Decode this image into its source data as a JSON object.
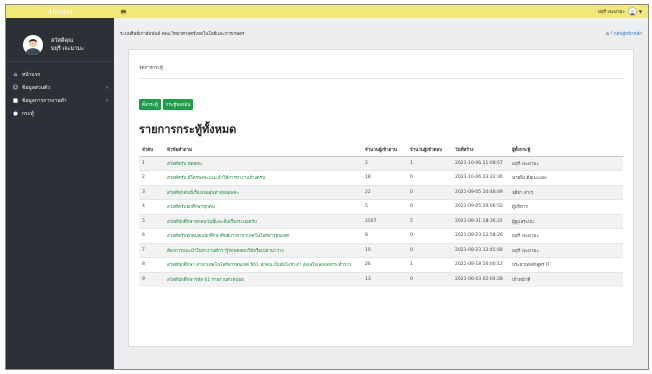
{
  "brand": {
    "logo_text": "Alumni"
  },
  "user": {
    "greeting": "สวัสดีคุณ",
    "name": "มยุรี เจะมามะ"
  },
  "sidebar": {
    "items": [
      {
        "label": "หน้าแรก",
        "icon": "home-icon",
        "has_arrow": false
      },
      {
        "label": "ข้อมูลส่วนตัว",
        "icon": "user-icon",
        "has_arrow": true
      },
      {
        "label": "ข้อมูลการการงานทำ",
        "icon": "briefcase-icon",
        "has_arrow": true
      },
      {
        "label": "กระทู้",
        "icon": "chat-icon",
        "has_arrow": false
      }
    ]
  },
  "topbar": {
    "user_name": "มยุรี เจะมามะ"
  },
  "header": {
    "page_heading": "ระบบศิษย์เก่าสัมพันธ์ คณะวิทยาศาสตร์เทคโนโลยีและการเกษตร",
    "breadcrumb": "กลับสู่หน้าหลัก"
  },
  "card": {
    "title": "จัดการกระทู้",
    "new_topic_button": "ตั้งกระทู้",
    "my_topics_button": "กระทู้ของฉัน",
    "list_title": "รายการกระทู้ทั้งหมด"
  },
  "table": {
    "columns": [
      "ลำดับ",
      "หัวข้อคำถาม",
      "จำนวนผู้เข้าอ่าน",
      "จำนวนผู้เข้าตอบ",
      "วันที่สร้าง",
      "ผู้ตั้งกระทู้"
    ],
    "rows": [
      [
        "1",
        "สวัสดีครับ ทดสอบ",
        "2",
        "1",
        "2021-10-06 11:08:57",
        "มยุรี เจะมามะ"
      ],
      [
        "2",
        "สวัสดีครับ มีใครพอจะแนะนำวิธีการหางานบ้างครับ",
        "18",
        "0",
        "2021-10-06 23:32:30",
        "นายยิง ดีสุเมะแยะ"
      ],
      [
        "3",
        "สวัสดีทุกคนนี่เรื่องเจอสุนทางหลอมคะ",
        "22",
        "0",
        "2021-09-05 10:48:49",
        "จุลียา สาเร"
      ],
      [
        "4",
        "สวัสดีครับนักศึกษาทุกคน",
        "5",
        "0",
        "2021-09-05 10:06:50",
        "ผู้บริหาร"
      ],
      [
        "5",
        "สวัสดีนักศึกษาทุกคนวันนี้และอินเรื่องระบบครับ",
        "2507",
        "5",
        "2021-08-31 18:36:22",
        "ผู้ดูแลระบบ"
      ],
      [
        "6",
        "สวัสดีครับทุกคนคนนักศึกษาศิษย์เก่าสาขาเทคโนโลยีสารสนเทศ",
        "8",
        "0",
        "2021-08-23 12:58:26",
        "มยุรี เจะมามะ"
      ],
      [
        "7",
        "ต้องการแนะนำในหางานดีกว่ารู้จักทดสอบวิธีหรือเปล่าน่าว่าง",
        "10",
        "0",
        "2021-08-23 12:45:48",
        "มยุรี เจะมามะ"
      ],
      [
        "8",
        "สวัสดีนักศึกษา สาขาเทคโนโลยีสารสนเทศ ปี61 ทุกคน เป็นยังไงบ้าง!! ลังเลใจเลยเลยกระท่ำววว",
        "26",
        "1",
        "2021-08-18 16:00:12",
        "ประธานหลักสูตร IT"
      ],
      [
        "9",
        "สวัสดีนักศึกษารหัส 61 รายงานตัวหน่อย",
        "13",
        "0",
        "2021-06-03 02:04:28",
        "เจ้าหน้าที่"
      ]
    ]
  },
  "colors": {
    "topbar": "#f0e97a",
    "sidebar": "#2b3137",
    "button": "#1e9e4a",
    "link": "#1a8a3a"
  }
}
